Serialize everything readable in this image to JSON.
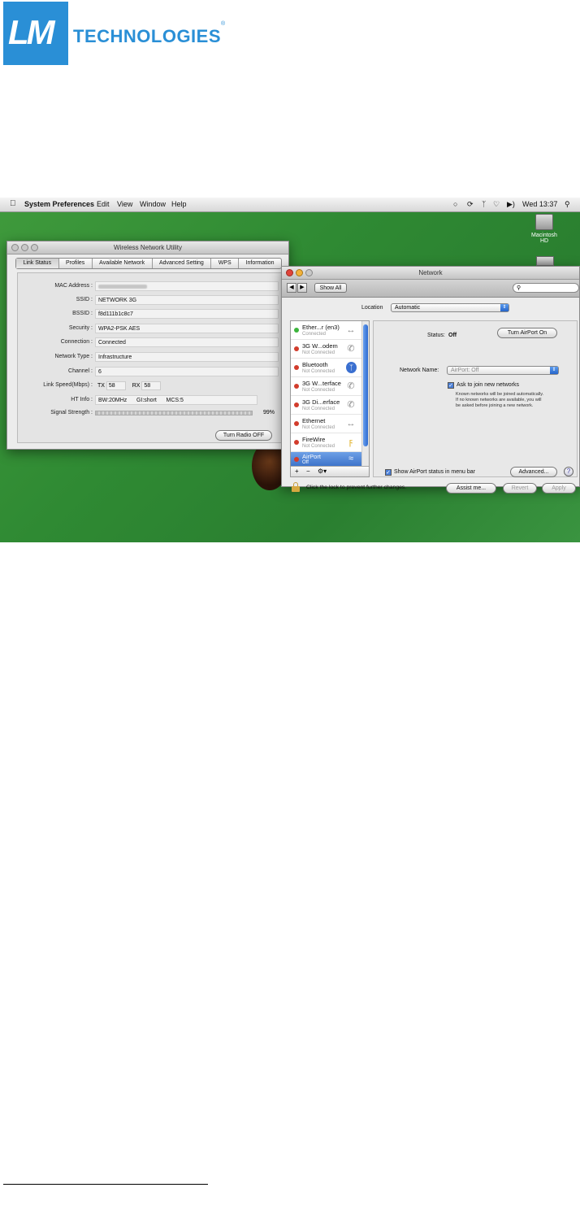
{
  "logo": {
    "mark": "LM",
    "word": "TECHNOLOGIES",
    "reg": "®"
  },
  "menubar": {
    "items": [
      "System Preferences",
      "Edit",
      "View",
      "Window",
      "Help"
    ],
    "clock": "Wed 13:37"
  },
  "desktop": {
    "disk_label": "Macintosh HD"
  },
  "wnu": {
    "title": "Wireless Network Utility",
    "tabs": [
      "Link Status",
      "Profiles",
      "Available Network",
      "Advanced Setting",
      "WPS",
      "Information"
    ],
    "fields": {
      "mac_label": "MAC Address :",
      "ssid_label": "SSID :",
      "ssid": "NETWORK 3G",
      "bssid_label": "BSSID :",
      "bssid": "f8d111b1c8c7",
      "security_label": "Security :",
      "security": "WPA2-PSK AES",
      "connection_label": "Connection :",
      "connection": "Connected",
      "network_type_label": "Network Type :",
      "network_type": "Infrastructure",
      "channel_label": "Channel :",
      "channel": "6",
      "link_speed_label": "Link Speed(Mbps) :",
      "tx_label": "TX",
      "tx": "58",
      "rx_label": "RX",
      "rx": "58",
      "ht_label": "HT Info :",
      "ht_bw": "BW:20MHz",
      "ht_gi": "GI:short",
      "ht_mcs": "MCS:5",
      "signal_label": "Signal Strength :",
      "signal_pct": "99%"
    },
    "button": "Turn Radio OFF"
  },
  "network": {
    "title": "Network",
    "show_all": "Show All",
    "location_label": "Location",
    "location": "Automatic",
    "services": [
      {
        "name": "Ether...r (en3)",
        "status": "Connected"
      },
      {
        "name": "3G W...odem",
        "status": "Not Connected"
      },
      {
        "name": "Bluetooth",
        "status": "Not Connected"
      },
      {
        "name": "3G W...terface",
        "status": "Not Connected"
      },
      {
        "name": "3G Di...erface",
        "status": "Not Connected"
      },
      {
        "name": "Ethernet",
        "status": "Not Connected"
      },
      {
        "name": "FireWire",
        "status": "Not Connected"
      },
      {
        "name": "AirPort",
        "status": "Off"
      }
    ],
    "status_label": "Status:",
    "status": "Off",
    "turn_on": "Turn AirPort On",
    "network_name_label": "Network Name:",
    "network_name": "AirPort: Off",
    "ask_join": "Ask to join new networks",
    "ask_note": [
      "Known networks will be joined automatically.",
      "If no known networks are available, you will",
      "be asked before joining a new network."
    ],
    "show_status": "Show AirPort status in menu bar",
    "advanced": "Advanced...",
    "help": "?",
    "lock_text": "Click the lock to prevent further changes.",
    "assist": "Assist me...",
    "revert": "Revert",
    "apply": "Apply"
  }
}
